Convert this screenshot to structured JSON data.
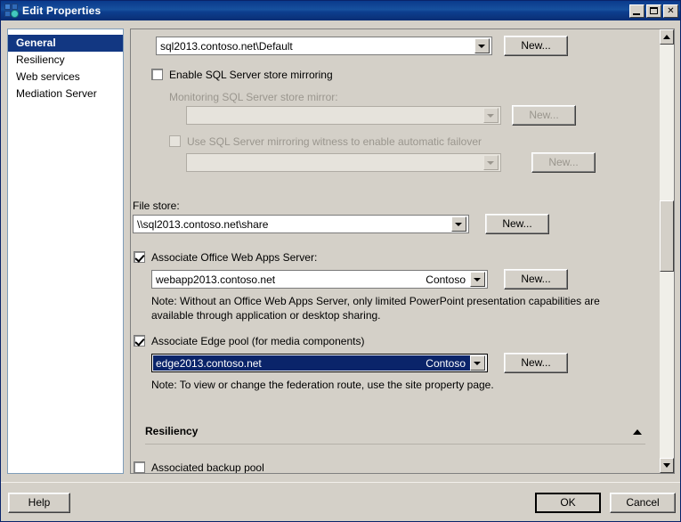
{
  "window": {
    "title": "Edit Properties",
    "icon": "properties-icon",
    "controls": {
      "minimize": "minimize-button",
      "maximize": "maximize-button",
      "close": "close-button",
      "close_glyph": "✕"
    }
  },
  "sidebar": {
    "items": [
      {
        "label": "General",
        "selected": true
      },
      {
        "label": "Resiliency",
        "selected": false
      },
      {
        "label": "Web services",
        "selected": false
      },
      {
        "label": "Mediation Server",
        "selected": false
      }
    ]
  },
  "main": {
    "sql_store": {
      "combo_value": "sql2013.contoso.net\\Default",
      "new_button": "New..."
    },
    "mirroring": {
      "checkbox_label": "Enable SQL Server store mirroring",
      "checked": false,
      "mirror_label": "Monitoring SQL Server store mirror:",
      "mirror_combo_value": "",
      "mirror_new_button": "New...",
      "witness_label": "Use SQL Server mirroring witness to enable automatic failover",
      "witness_checked": false,
      "witness_combo_value": "",
      "witness_new_button": "New..."
    },
    "file_store": {
      "label": "File store:",
      "combo_value": "\\\\sql2013.contoso.net\\share",
      "new_button": "New..."
    },
    "office_web_apps": {
      "checkbox_label": "Associate Office Web Apps Server:",
      "checked": true,
      "combo_value": "webapp2013.contoso.net",
      "combo_suffix": "Contoso",
      "new_button": "New...",
      "note": "Note: Without an Office Web Apps Server, only limited PowerPoint presentation capabilities are available through application or desktop sharing."
    },
    "edge_pool": {
      "checkbox_label": "Associate Edge pool (for media components)",
      "checked": true,
      "combo_value": "edge2013.contoso.net",
      "combo_suffix": "Contoso",
      "focused": true,
      "new_button": "New...",
      "note": "Note: To view or change the federation route, use the site property page."
    },
    "resiliency_section": {
      "title": "Resiliency",
      "collapse_icon": "chevron-up-icon",
      "backup_pool_label": "Associated backup pool",
      "backup_pool_checked": false
    }
  },
  "footer": {
    "help_button": "Help",
    "ok_button": "OK",
    "cancel_button": "Cancel"
  },
  "colors": {
    "titlebar": "#0a3a8c",
    "selection": "#123782",
    "face": "#d4d0c8",
    "disabled_text": "#9a968e"
  }
}
